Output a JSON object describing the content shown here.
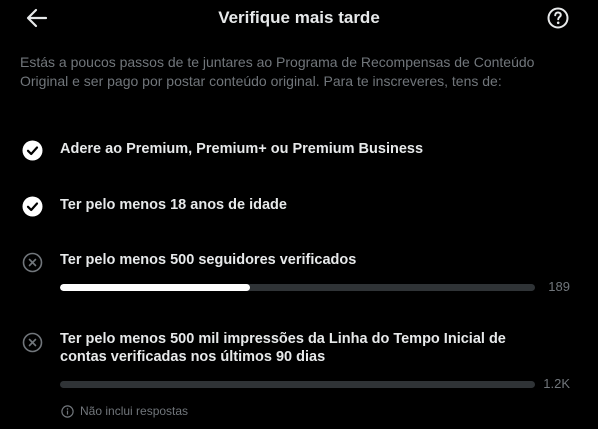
{
  "header": {
    "title": "Verifique mais tarde",
    "back_icon": "arrow-left-icon",
    "help_icon": "question-circle-icon"
  },
  "intro": "Estás a poucos passos de te juntares ao Programa de Recompensas de Conteúdo Original e ser pago por postar conteúdo original. Para te inscreveres, tens de:",
  "requirements": [
    {
      "label": "Adere ao Premium, Premium+ ou Premium Business",
      "met": true,
      "icon": "check-circle-icon"
    },
    {
      "label": "Ter pelo menos 18 anos de idade",
      "met": true,
      "icon": "check-circle-icon"
    },
    {
      "label": "Ter pelo menos 500 seguidores verificados",
      "met": false,
      "icon": "x-circle-icon",
      "progress": {
        "value_label": "189",
        "fraction": 0.4
      }
    },
    {
      "label": "Ter pelo menos 500 mil impressões da Linha do Tempo Inicial de contas verificadas nos últimos 90 dias",
      "met": false,
      "icon": "x-circle-icon",
      "progress": {
        "value_label": "1.2K",
        "fraction": 0.0
      },
      "note": "Não inclui respostas"
    }
  ],
  "colors": {
    "background": "#000000",
    "text": "#e7e9ea",
    "muted": "#71767b",
    "track": "#2f3336",
    "fill": "#ffffff"
  }
}
